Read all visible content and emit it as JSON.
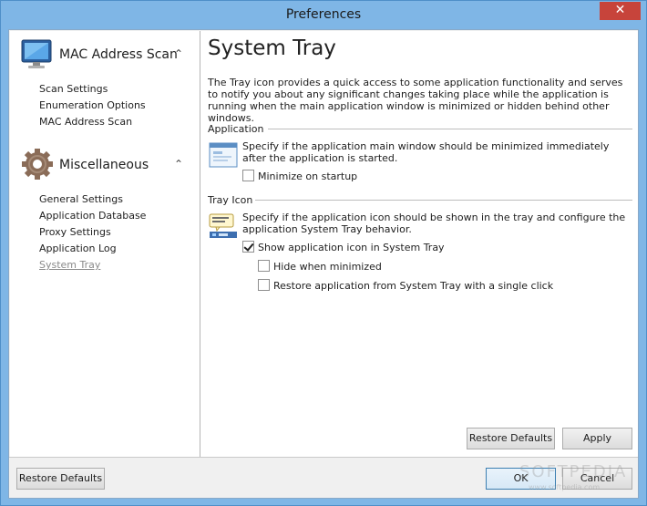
{
  "window": {
    "title": "Preferences",
    "close_glyph": "✕"
  },
  "sidebar": {
    "groups": [
      {
        "title": "MAC Address Scan",
        "icon": "monitor-icon",
        "chevron": "⌃",
        "items": [
          "Scan Settings",
          "Enumeration Options",
          "MAC Address Scan"
        ]
      },
      {
        "title": "Miscellaneous",
        "icon": "gear-icon",
        "chevron": "⌃",
        "items": [
          "General Settings",
          "Application Database",
          "Proxy Settings",
          "Application Log",
          "System Tray"
        ]
      }
    ],
    "active_item": "System Tray"
  },
  "content": {
    "title": "System Tray",
    "description": "The Tray icon provides a quick access to some application functionality and serves to notify you about any significant changes taking place while the application is running when the main application window is minimized or hidden behind other windows.",
    "application_section": {
      "title": "Application",
      "text": "Specify if the application main window should be minimized immediately after the application is started.",
      "minimize_on_startup": {
        "label": "Minimize on startup",
        "checked": false
      }
    },
    "tray_icon_section": {
      "title": "Tray Icon",
      "text": "Specify if the application icon should be shown in the tray and configure the application System Tray behavior.",
      "show_icon": {
        "label": "Show application icon in System Tray",
        "checked": true
      },
      "hide_when_minimized": {
        "label": "Hide when minimized",
        "checked": false
      },
      "restore_single_click": {
        "label": "Restore application from System Tray with a single click",
        "checked": false
      }
    },
    "buttons": {
      "restore_defaults": "Restore Defaults",
      "apply": "Apply"
    }
  },
  "footer": {
    "restore_defaults": "Restore Defaults",
    "ok": "OK",
    "cancel": "Cancel"
  },
  "watermark": {
    "text": "SOFTPEDIA",
    "url": "www.softpedia.com"
  },
  "colors": {
    "titlebar": "#7fb6e6",
    "close": "#c7443b",
    "active_nav": "#8a8a8a",
    "default_button_border": "#3c7fb1"
  }
}
